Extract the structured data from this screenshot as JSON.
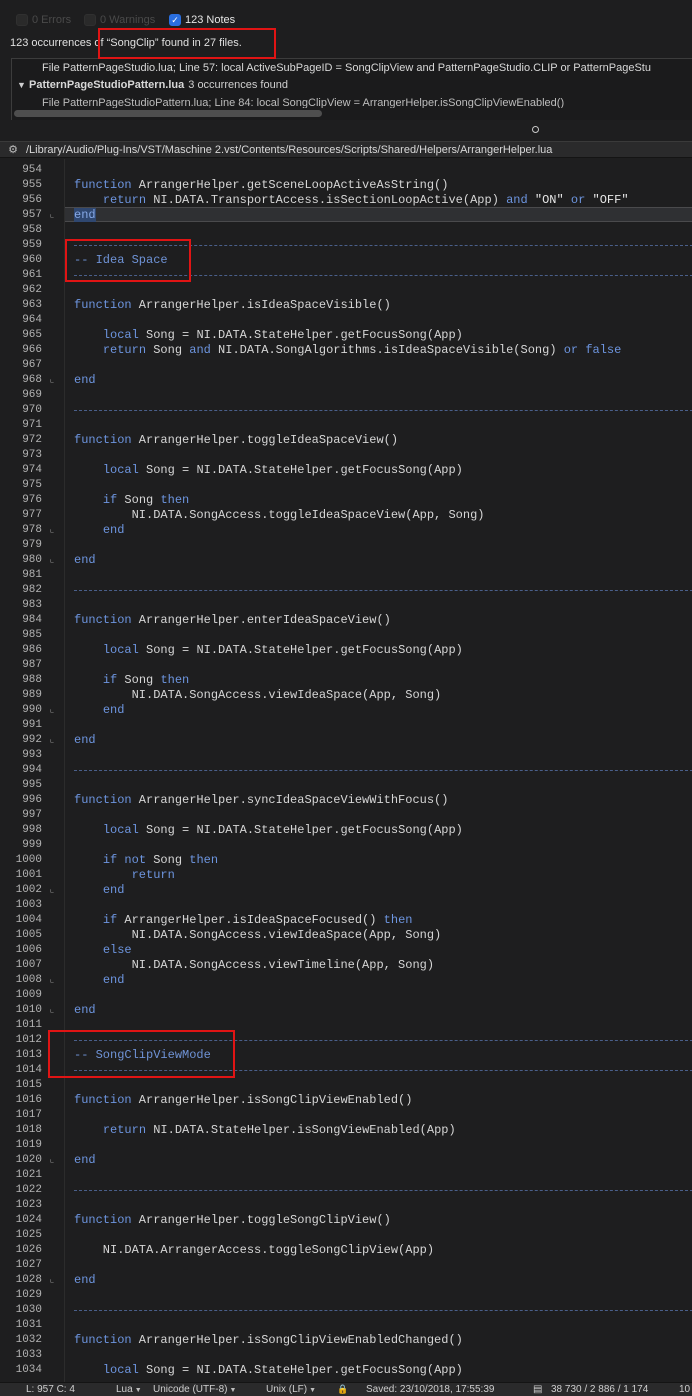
{
  "filters": {
    "errors": "0 Errors",
    "warnings": "0 Warnings",
    "notes": "123 Notes",
    "notes_check": "✓"
  },
  "search": {
    "summary_prefix": "123 occurrences ",
    "summary_highlight": "of “SongClip” found in 27 files."
  },
  "results": [
    {
      "kind": "row",
      "text": "File PatternPageStudio.lua; Line 57:      local ActiveSubPageID = SongClipView and PatternPageStudio.CLIP or PatternPageStu"
    },
    {
      "kind": "group",
      "name": "PatternPageStudioPattern.lua",
      "count": "3 occurrences found",
      "triangle": "▼"
    },
    {
      "kind": "row",
      "text": "File PatternPageStudioPattern.lua; Line 84:      local SongClipView = ArrangerHelper.isSongClipViewEnabled()"
    }
  ],
  "path_bar": {
    "gear": "⚙",
    "path": "/Library/Audio/Plug-Ins/VST/Maschine 2.vst/Contents/Resources/Scripts/Shared/Helpers/ArrangerHelper.lua"
  },
  "editor": {
    "current_line": 957,
    "lines": [
      {
        "n": 954,
        "fold": "",
        "seg": []
      },
      {
        "n": 955,
        "fold": "",
        "seg": [
          [
            "kw",
            "function"
          ],
          [
            "plain",
            " ArrangerHelper.getSceneLoopActiveAsString()"
          ]
        ]
      },
      {
        "n": 956,
        "fold": "",
        "seg": [
          [
            "plain",
            "    "
          ],
          [
            "kw",
            "return"
          ],
          [
            "plain",
            " NI.DATA.TransportAccess.isSectionLoopActive(App) "
          ],
          [
            "kw",
            "and"
          ],
          [
            "plain",
            " "
          ],
          [
            "str",
            "\"ON\""
          ],
          [
            "plain",
            " "
          ],
          [
            "kw",
            "or"
          ],
          [
            "plain",
            " "
          ],
          [
            "str",
            "\"OFF\""
          ]
        ]
      },
      {
        "n": 957,
        "fold": "⌞",
        "seg": [
          [
            "sel",
            "end"
          ]
        ]
      },
      {
        "n": 958,
        "fold": "",
        "seg": []
      },
      {
        "n": 959,
        "fold": "",
        "sep": true
      },
      {
        "n": 960,
        "fold": "",
        "seg": [
          [
            "cmt",
            "-- Idea Space"
          ]
        ]
      },
      {
        "n": 961,
        "fold": "",
        "sep": true
      },
      {
        "n": 962,
        "fold": "",
        "seg": []
      },
      {
        "n": 963,
        "fold": "",
        "seg": [
          [
            "kw",
            "function"
          ],
          [
            "plain",
            " ArrangerHelper.isIdeaSpaceVisible()"
          ]
        ]
      },
      {
        "n": 964,
        "fold": "",
        "seg": []
      },
      {
        "n": 965,
        "fold": "",
        "seg": [
          [
            "plain",
            "    "
          ],
          [
            "kw",
            "local"
          ],
          [
            "plain",
            " Song = NI.DATA.StateHelper.getFocusSong(App)"
          ]
        ]
      },
      {
        "n": 966,
        "fold": "",
        "seg": [
          [
            "plain",
            "    "
          ],
          [
            "kw",
            "return"
          ],
          [
            "plain",
            " Song "
          ],
          [
            "kw",
            "and"
          ],
          [
            "plain",
            " NI.DATA.SongAlgorithms.isIdeaSpaceVisible(Song) "
          ],
          [
            "kw",
            "or"
          ],
          [
            "plain",
            " "
          ],
          [
            "kw",
            "false"
          ]
        ]
      },
      {
        "n": 967,
        "fold": "",
        "seg": []
      },
      {
        "n": 968,
        "fold": "⌞",
        "seg": [
          [
            "kw",
            "end"
          ]
        ]
      },
      {
        "n": 969,
        "fold": "",
        "seg": []
      },
      {
        "n": 970,
        "fold": "",
        "sep": true
      },
      {
        "n": 971,
        "fold": "",
        "seg": []
      },
      {
        "n": 972,
        "fold": "",
        "seg": [
          [
            "kw",
            "function"
          ],
          [
            "plain",
            " ArrangerHelper.toggleIdeaSpaceView()"
          ]
        ]
      },
      {
        "n": 973,
        "fold": "",
        "seg": []
      },
      {
        "n": 974,
        "fold": "",
        "seg": [
          [
            "plain",
            "    "
          ],
          [
            "kw",
            "local"
          ],
          [
            "plain",
            " Song = NI.DATA.StateHelper.getFocusSong(App)"
          ]
        ]
      },
      {
        "n": 975,
        "fold": "",
        "seg": []
      },
      {
        "n": 976,
        "fold": "",
        "seg": [
          [
            "plain",
            "    "
          ],
          [
            "kw",
            "if"
          ],
          [
            "plain",
            " Song "
          ],
          [
            "kw",
            "then"
          ]
        ]
      },
      {
        "n": 977,
        "fold": "",
        "seg": [
          [
            "plain",
            "        NI.DATA.SongAccess.toggleIdeaSpaceView(App, Song)"
          ]
        ]
      },
      {
        "n": 978,
        "fold": "⌞",
        "seg": [
          [
            "plain",
            "    "
          ],
          [
            "kw",
            "end"
          ]
        ]
      },
      {
        "n": 979,
        "fold": "",
        "seg": []
      },
      {
        "n": 980,
        "fold": "⌞",
        "seg": [
          [
            "kw",
            "end"
          ]
        ]
      },
      {
        "n": 981,
        "fold": "",
        "seg": []
      },
      {
        "n": 982,
        "fold": "",
        "sep": true
      },
      {
        "n": 983,
        "fold": "",
        "seg": []
      },
      {
        "n": 984,
        "fold": "",
        "seg": [
          [
            "kw",
            "function"
          ],
          [
            "plain",
            " ArrangerHelper.enterIdeaSpaceView()"
          ]
        ]
      },
      {
        "n": 985,
        "fold": "",
        "seg": []
      },
      {
        "n": 986,
        "fold": "",
        "seg": [
          [
            "plain",
            "    "
          ],
          [
            "kw",
            "local"
          ],
          [
            "plain",
            " Song = NI.DATA.StateHelper.getFocusSong(App)"
          ]
        ]
      },
      {
        "n": 987,
        "fold": "",
        "seg": []
      },
      {
        "n": 988,
        "fold": "",
        "seg": [
          [
            "plain",
            "    "
          ],
          [
            "kw",
            "if"
          ],
          [
            "plain",
            " Song "
          ],
          [
            "kw",
            "then"
          ]
        ]
      },
      {
        "n": 989,
        "fold": "",
        "seg": [
          [
            "plain",
            "        NI.DATA.SongAccess.viewIdeaSpace(App, Song)"
          ]
        ]
      },
      {
        "n": 990,
        "fold": "⌞",
        "seg": [
          [
            "plain",
            "    "
          ],
          [
            "kw",
            "end"
          ]
        ]
      },
      {
        "n": 991,
        "fold": "",
        "seg": []
      },
      {
        "n": 992,
        "fold": "⌞",
        "seg": [
          [
            "kw",
            "end"
          ]
        ]
      },
      {
        "n": 993,
        "fold": "",
        "seg": []
      },
      {
        "n": 994,
        "fold": "",
        "sep": true
      },
      {
        "n": 995,
        "fold": "",
        "seg": []
      },
      {
        "n": 996,
        "fold": "",
        "seg": [
          [
            "kw",
            "function"
          ],
          [
            "plain",
            " ArrangerHelper.syncIdeaSpaceViewWithFocus()"
          ]
        ]
      },
      {
        "n": 997,
        "fold": "",
        "seg": []
      },
      {
        "n": 998,
        "fold": "",
        "seg": [
          [
            "plain",
            "    "
          ],
          [
            "kw",
            "local"
          ],
          [
            "plain",
            " Song = NI.DATA.StateHelper.getFocusSong(App)"
          ]
        ]
      },
      {
        "n": 999,
        "fold": "",
        "seg": []
      },
      {
        "n": 1000,
        "fold": "",
        "seg": [
          [
            "plain",
            "    "
          ],
          [
            "kw",
            "if not"
          ],
          [
            "plain",
            " Song "
          ],
          [
            "kw",
            "then"
          ]
        ]
      },
      {
        "n": 1001,
        "fold": "",
        "seg": [
          [
            "plain",
            "        "
          ],
          [
            "kw",
            "return"
          ]
        ]
      },
      {
        "n": 1002,
        "fold": "⌞",
        "seg": [
          [
            "plain",
            "    "
          ],
          [
            "kw",
            "end"
          ]
        ]
      },
      {
        "n": 1003,
        "fold": "",
        "seg": []
      },
      {
        "n": 1004,
        "fold": "",
        "seg": [
          [
            "plain",
            "    "
          ],
          [
            "kw",
            "if"
          ],
          [
            "plain",
            " ArrangerHelper.isIdeaSpaceFocused() "
          ],
          [
            "kw",
            "then"
          ]
        ]
      },
      {
        "n": 1005,
        "fold": "",
        "seg": [
          [
            "plain",
            "        NI.DATA.SongAccess.viewIdeaSpace(App, Song)"
          ]
        ]
      },
      {
        "n": 1006,
        "fold": "",
        "seg": [
          [
            "plain",
            "    "
          ],
          [
            "kw",
            "else"
          ]
        ]
      },
      {
        "n": 1007,
        "fold": "",
        "seg": [
          [
            "plain",
            "        NI.DATA.SongAccess.viewTimeline(App, Song)"
          ]
        ]
      },
      {
        "n": 1008,
        "fold": "⌞",
        "seg": [
          [
            "plain",
            "    "
          ],
          [
            "kw",
            "end"
          ]
        ]
      },
      {
        "n": 1009,
        "fold": "",
        "seg": []
      },
      {
        "n": 1010,
        "fold": "⌞",
        "seg": [
          [
            "kw",
            "end"
          ]
        ]
      },
      {
        "n": 1011,
        "fold": "",
        "seg": []
      },
      {
        "n": 1012,
        "fold": "",
        "sep": true
      },
      {
        "n": 1013,
        "fold": "",
        "seg": [
          [
            "cmt",
            "-- SongClipViewMode"
          ]
        ]
      },
      {
        "n": 1014,
        "fold": "",
        "sep": true
      },
      {
        "n": 1015,
        "fold": "",
        "seg": []
      },
      {
        "n": 1016,
        "fold": "",
        "seg": [
          [
            "kw",
            "function"
          ],
          [
            "plain",
            " ArrangerHelper.isSongClipViewEnabled()"
          ]
        ]
      },
      {
        "n": 1017,
        "fold": "",
        "seg": []
      },
      {
        "n": 1018,
        "fold": "",
        "seg": [
          [
            "plain",
            "    "
          ],
          [
            "kw",
            "return"
          ],
          [
            "plain",
            " NI.DATA.StateHelper.isSongViewEnabled(App)"
          ]
        ]
      },
      {
        "n": 1019,
        "fold": "",
        "seg": []
      },
      {
        "n": 1020,
        "fold": "⌞",
        "seg": [
          [
            "kw",
            "end"
          ]
        ]
      },
      {
        "n": 1021,
        "fold": "",
        "seg": []
      },
      {
        "n": 1022,
        "fold": "",
        "sep": true
      },
      {
        "n": 1023,
        "fold": "",
        "seg": []
      },
      {
        "n": 1024,
        "fold": "",
        "seg": [
          [
            "kw",
            "function"
          ],
          [
            "plain",
            " ArrangerHelper.toggleSongClipView()"
          ]
        ]
      },
      {
        "n": 1025,
        "fold": "",
        "seg": []
      },
      {
        "n": 1026,
        "fold": "",
        "seg": [
          [
            "plain",
            "    NI.DATA.ArrangerAccess.toggleSongClipView(App)"
          ]
        ]
      },
      {
        "n": 1027,
        "fold": "",
        "seg": []
      },
      {
        "n": 1028,
        "fold": "⌞",
        "seg": [
          [
            "kw",
            "end"
          ]
        ]
      },
      {
        "n": 1029,
        "fold": "",
        "seg": []
      },
      {
        "n": 1030,
        "fold": "",
        "sep": true
      },
      {
        "n": 1031,
        "fold": "",
        "seg": []
      },
      {
        "n": 1032,
        "fold": "",
        "seg": [
          [
            "kw",
            "function"
          ],
          [
            "plain",
            " ArrangerHelper.isSongClipViewEnabledChanged()"
          ]
        ]
      },
      {
        "n": 1033,
        "fold": "",
        "seg": []
      },
      {
        "n": 1034,
        "fold": "",
        "seg": [
          [
            "plain",
            "    "
          ],
          [
            "kw",
            "local"
          ],
          [
            "plain",
            " Song = NI.DATA.StateHelper.getFocusSong(App)"
          ]
        ]
      }
    ]
  },
  "status": {
    "position": "L: 957 C: 4",
    "language": "Lua",
    "encoding": "Unicode (UTF-8)",
    "line_endings": "Unix (LF)",
    "lock": "🔒",
    "saved": "Saved: 23/10/2018, 17:55:39",
    "doc_icon": "▤",
    "stats": "38 730 / 2 886 / 1 174",
    "extra": "10"
  },
  "colors": {
    "background": "#1e1e1f",
    "keyword": "#6d95df",
    "comment": "#6f93d6",
    "annotation": "#e01414",
    "checkbox": "#2a6fe0"
  }
}
